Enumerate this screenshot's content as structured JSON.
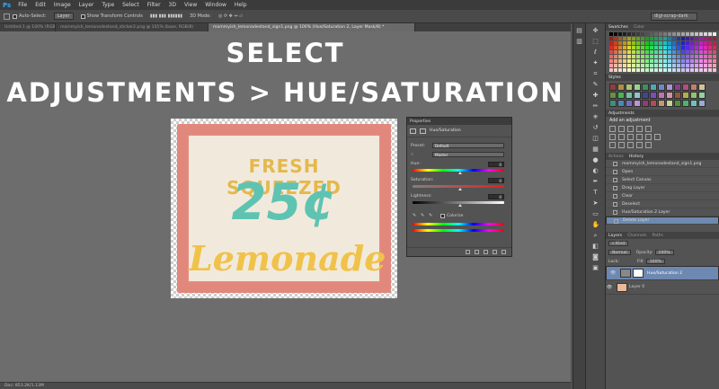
{
  "app": {
    "logo": "Ps"
  },
  "menu": [
    "File",
    "Edit",
    "Image",
    "Layer",
    "Type",
    "Select",
    "Filter",
    "3D",
    "View",
    "Window",
    "Help"
  ],
  "options": {
    "auto_select": "Auto-Select:",
    "auto_select_value": "Layer",
    "show_transform": "Show Transform Controls",
    "mode_3d": "3D Mode:",
    "workspace": "digi-scrap-dark"
  },
  "doc_tabs": [
    {
      "label": "Untitled-1 @ 100% (RGB/8) *",
      "active": false
    },
    {
      "label": "mommyish_lemonadestand_sticker2.png @ 101% (base, RGB/8)",
      "active": false
    },
    {
      "label": "mommyish_lemonadestand_sign1.png @ 100% (Hue/Saturation 2, Layer Mask/8) *",
      "active": true
    }
  ],
  "overlay": {
    "line1": "SELECT",
    "line2": "ADJUSTMENTS > HUE/SATURATION"
  },
  "sign": {
    "line1": "FRESH SQUEEZED",
    "price": "25¢",
    "line3": "Lemonade"
  },
  "status": {
    "text": "Doc: 853.2K/1.13M"
  },
  "properties": {
    "title": "Properties",
    "layer": "Hue/Saturation",
    "preset_label": "Preset:",
    "preset_value": "Default",
    "channel_value": "Master",
    "hue_label": "Hue:",
    "hue_value": "0",
    "sat_label": "Saturation:",
    "sat_value": "0",
    "light_label": "Lightness:",
    "light_value": "0",
    "colorize": "Colorize",
    "hue_thumb": 0.5,
    "sat_thumb": 0.5,
    "light_thumb": 0.5
  },
  "panels": {
    "swatches_tabs": [
      "Swatches",
      "Color"
    ],
    "styles_tab": "Styles",
    "adjustments_tab": "Adjustments",
    "adjustments_title": "Add an adjustment",
    "history_tabs": [
      "Actions",
      "History"
    ],
    "history_source": "mommyish_lemonadestand_sign1.png",
    "history": [
      "Open",
      "Select Canvas",
      "Drag Layer",
      "Clear",
      "Deselect",
      "Hue/Saturation 2 Layer",
      "Delete Layer"
    ],
    "layers_tabs": [
      "Layers",
      "Channels",
      "Paths"
    ],
    "kind_label": "Kind",
    "blend_mode": "Normal",
    "opacity_label": "Opacity:",
    "opacity_value": "100%",
    "lock_label": "Lock:",
    "fill_label": "Fill:",
    "fill_value": "100%",
    "layers": [
      {
        "name": "Hue/Saturation 2",
        "selected": true
      },
      {
        "name": "Layer 0",
        "selected": false
      }
    ]
  }
}
